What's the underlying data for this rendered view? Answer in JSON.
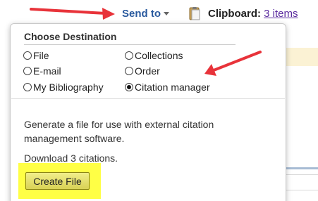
{
  "header": {
    "send_to_label": "Send to",
    "clipboard_label": "Clipboard:",
    "clipboard_count": "3 items"
  },
  "dropdown": {
    "title": "Choose Destination",
    "options": [
      {
        "label": "File",
        "checked": false
      },
      {
        "label": "Collections",
        "checked": false
      },
      {
        "label": "E-mail",
        "checked": false
      },
      {
        "label": "Order",
        "checked": false
      },
      {
        "label": "My Bibliography",
        "checked": false
      },
      {
        "label": "Citation manager",
        "checked": true
      }
    ],
    "description": "Generate a file for use with external citation management software.",
    "download_text": "Download 3 citations.",
    "create_button_label": "Create File"
  },
  "annotations": {
    "arrow_color": "#e8333a",
    "highlight_color": "#ffff45"
  },
  "colors": {
    "link_blue": "#2a5a9e",
    "clipboard_link": "#5a2a9e"
  }
}
